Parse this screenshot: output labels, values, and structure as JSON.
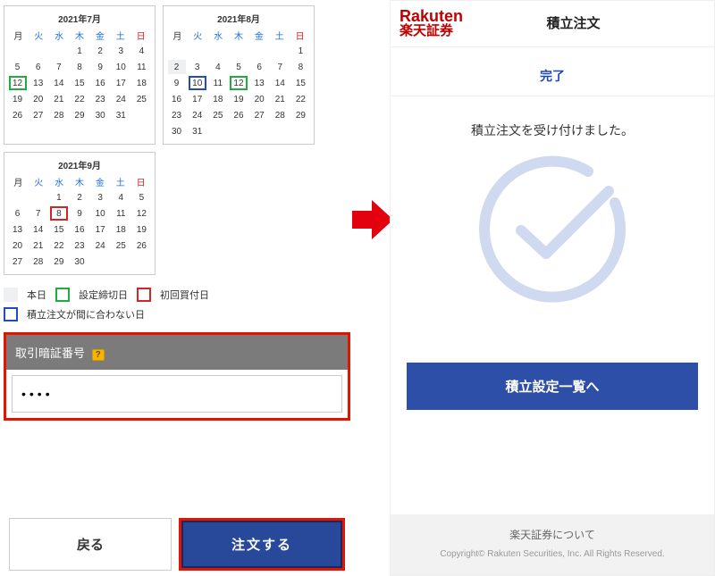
{
  "calendars": [
    {
      "title": "2021年7月",
      "dow": [
        "月",
        "火",
        "水",
        "木",
        "金",
        "土",
        "日"
      ],
      "cells": [
        {
          "n": ""
        },
        {
          "n": ""
        },
        {
          "n": ""
        },
        {
          "n": "1"
        },
        {
          "n": "2"
        },
        {
          "n": "3"
        },
        {
          "n": "4"
        },
        {
          "n": "5"
        },
        {
          "n": "6"
        },
        {
          "n": "7"
        },
        {
          "n": "8"
        },
        {
          "n": "9"
        },
        {
          "n": "10"
        },
        {
          "n": "11"
        },
        {
          "n": "12",
          "c": "deadline"
        },
        {
          "n": "13"
        },
        {
          "n": "14"
        },
        {
          "n": "15"
        },
        {
          "n": "16"
        },
        {
          "n": "17"
        },
        {
          "n": "18"
        },
        {
          "n": "19"
        },
        {
          "n": "20"
        },
        {
          "n": "21"
        },
        {
          "n": "22"
        },
        {
          "n": "23"
        },
        {
          "n": "24"
        },
        {
          "n": "25"
        },
        {
          "n": "26"
        },
        {
          "n": "27"
        },
        {
          "n": "28"
        },
        {
          "n": "29"
        },
        {
          "n": "30"
        },
        {
          "n": "31"
        },
        {
          "n": ""
        }
      ]
    },
    {
      "title": "2021年8月",
      "dow": [
        "月",
        "火",
        "水",
        "木",
        "金",
        "土",
        "日"
      ],
      "cells": [
        {
          "n": ""
        },
        {
          "n": ""
        },
        {
          "n": ""
        },
        {
          "n": ""
        },
        {
          "n": ""
        },
        {
          "n": ""
        },
        {
          "n": "1"
        },
        {
          "n": "2",
          "c": "gray"
        },
        {
          "n": "3"
        },
        {
          "n": "4"
        },
        {
          "n": "5"
        },
        {
          "n": "6"
        },
        {
          "n": "7"
        },
        {
          "n": "8"
        },
        {
          "n": "9"
        },
        {
          "n": "10",
          "c": "late"
        },
        {
          "n": "11"
        },
        {
          "n": "12",
          "c": "deadline"
        },
        {
          "n": "13"
        },
        {
          "n": "14"
        },
        {
          "n": "15"
        },
        {
          "n": "16"
        },
        {
          "n": "17"
        },
        {
          "n": "18"
        },
        {
          "n": "19"
        },
        {
          "n": "20"
        },
        {
          "n": "21"
        },
        {
          "n": "22"
        },
        {
          "n": "23"
        },
        {
          "n": "24"
        },
        {
          "n": "25"
        },
        {
          "n": "26"
        },
        {
          "n": "27"
        },
        {
          "n": "28"
        },
        {
          "n": "29"
        },
        {
          "n": "30"
        },
        {
          "n": "31"
        },
        {
          "n": ""
        },
        {
          "n": ""
        },
        {
          "n": ""
        },
        {
          "n": ""
        },
        {
          "n": ""
        }
      ]
    },
    {
      "title": "2021年9月",
      "dow": [
        "月",
        "火",
        "水",
        "木",
        "金",
        "土",
        "日"
      ],
      "cells": [
        {
          "n": ""
        },
        {
          "n": ""
        },
        {
          "n": "1"
        },
        {
          "n": "2"
        },
        {
          "n": "3"
        },
        {
          "n": "4"
        },
        {
          "n": "5"
        },
        {
          "n": "6"
        },
        {
          "n": "7"
        },
        {
          "n": "8",
          "c": "first"
        },
        {
          "n": "9"
        },
        {
          "n": "10"
        },
        {
          "n": "11"
        },
        {
          "n": "12"
        },
        {
          "n": "13"
        },
        {
          "n": "14"
        },
        {
          "n": "15"
        },
        {
          "n": "16"
        },
        {
          "n": "17"
        },
        {
          "n": "18"
        },
        {
          "n": "19"
        },
        {
          "n": "20"
        },
        {
          "n": "21"
        },
        {
          "n": "22"
        },
        {
          "n": "23"
        },
        {
          "n": "24"
        },
        {
          "n": "25"
        },
        {
          "n": "26"
        },
        {
          "n": "27"
        },
        {
          "n": "28"
        },
        {
          "n": "29"
        },
        {
          "n": "30"
        },
        {
          "n": ""
        },
        {
          "n": ""
        },
        {
          "n": ""
        }
      ]
    }
  ],
  "legend": {
    "today": "本日",
    "deadline": "設定締切日",
    "first": "初回買付日",
    "late": "積立注文が間に合わない日"
  },
  "pin": {
    "label": "取引暗証番号",
    "help": "?",
    "value": "••••"
  },
  "buttons": {
    "back": "戻る",
    "order": "注文する"
  },
  "right": {
    "logo_en": "Rakuten",
    "logo_ja": "楽天証券",
    "title": "積立注文",
    "done": "完了",
    "message": "積立注文を受け付けました。",
    "list_btn": "積立設定一覧へ",
    "about": "楽天証券について",
    "copyright": "Copyright© Rakuten Securities, Inc. All Rights Reserved."
  }
}
